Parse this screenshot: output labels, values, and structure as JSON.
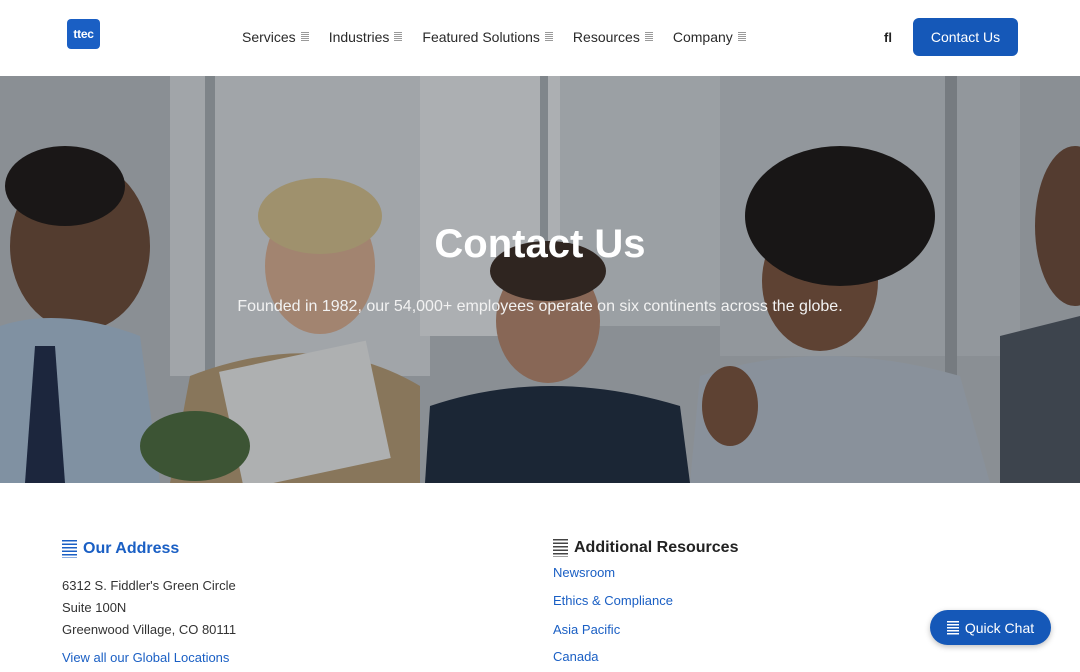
{
  "header": {
    "logo_text": "ttec",
    "nav": [
      {
        "label": "Services"
      },
      {
        "label": "Industries"
      },
      {
        "label": "Featured Solutions"
      },
      {
        "label": "Resources"
      },
      {
        "label": "Company"
      }
    ],
    "search_glyph": "fl",
    "contact_label": "Contact Us"
  },
  "hero": {
    "title": "Contact Us",
    "subtitle": "Founded in 1982, our 54,000+ employees operate on six continents across the globe."
  },
  "address": {
    "heading": "Our Address",
    "lines": [
      "6312 S. Fiddler's Green Circle",
      "Suite 100N",
      "Greenwood Village, CO 80111"
    ],
    "link": "View all our Global Locations"
  },
  "resources": {
    "heading": "Additional Resources",
    "links": [
      "Newsroom",
      "Ethics & Compliance",
      "Asia Pacific",
      "Canada"
    ]
  },
  "chat": {
    "label": "Quick Chat"
  },
  "colors": {
    "brand": "#1558b8",
    "link": "#1a5fc4"
  }
}
